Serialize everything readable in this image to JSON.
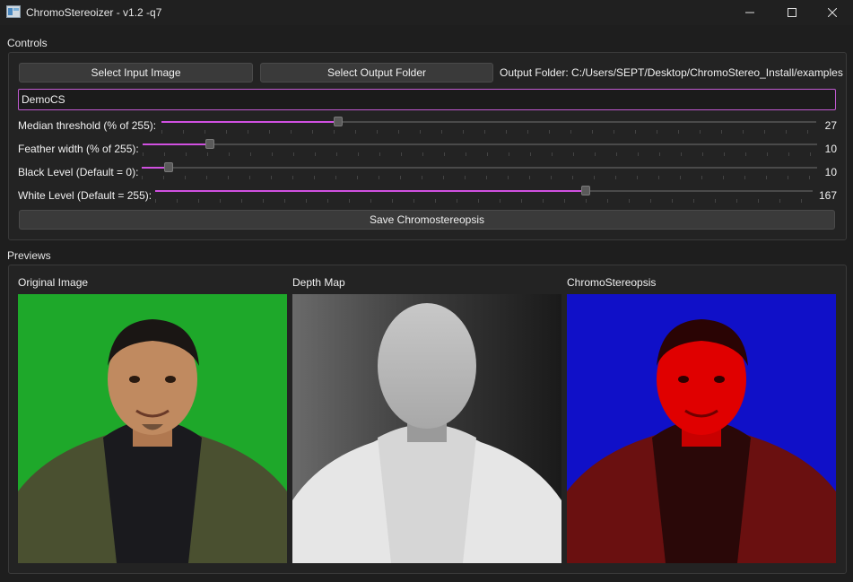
{
  "window": {
    "title": "ChromoStereoizer - v1.2 -q7",
    "icons": [
      "app-icon",
      "minimize-icon",
      "maximize-icon",
      "close-icon"
    ]
  },
  "controls": {
    "section_label": "Controls",
    "select_input_label": "Select Input Image",
    "select_output_label": "Select Output Folder",
    "output_folder_text": "Output Folder: C:/Users/SEPT/Desktop/ChromoStereo_Install/examples",
    "name_input_value": "DemoCS",
    "accent_color": "#d050e0",
    "sliders": [
      {
        "label": "Median threshold (% of 255):",
        "value": "27",
        "min": 0,
        "max": 100,
        "level": 27
      },
      {
        "label": "Feather width (% of 255):",
        "value": "10",
        "min": 0,
        "max": 100,
        "level": 10
      },
      {
        "label": "Black Level (Default = 0):",
        "value": "10",
        "min": 0,
        "max": 255,
        "level": 10
      },
      {
        "label": "White Level (Default = 255):",
        "value": "167",
        "min": 0,
        "max": 255,
        "level": 167
      }
    ],
    "save_label": "Save Chromostereopsis"
  },
  "previews": {
    "section_label": "Previews",
    "original_label": "Original Image",
    "depth_label": "Depth Map",
    "chromo_label": "ChromoStereopsis"
  }
}
